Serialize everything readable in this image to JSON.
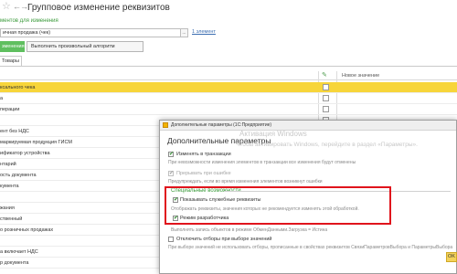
{
  "window": {
    "title": "Групповое изменение реквизитов",
    "star_icon": "star-icon",
    "back_icon": "←",
    "forward_icon": "→"
  },
  "form": {
    "section_label": "ментов для изменения",
    "combo_value": "ичная продажа (чек)",
    "combo_link": "1 элемент",
    "action_button": "зменения",
    "algorithm_button": "Выполнить произвольный алгоритм",
    "tab_label": "Товары"
  },
  "table": {
    "pencil_icon": "✎",
    "new_value_header": "Новое значение",
    "rows": [
      {
        "label": "ксального чека",
        "selected": true
      },
      {
        "label": "а",
        "selected": false
      },
      {
        "label": "перации",
        "selected": false
      },
      {
        "label": "",
        "selected": false
      },
      {
        "label": "ент без НДС",
        "selected": false
      },
      {
        "label": "маркируемая продукция ГИСМ",
        "selected": false
      },
      {
        "label": "ификатор устройства",
        "selected": false
      },
      {
        "label": "нтарий",
        "selected": false
      },
      {
        "label": "ость документа",
        "selected": false
      },
      {
        "label": "кумента",
        "selected": false
      },
      {
        "label": "",
        "selected": false
      },
      {
        "label": "жания",
        "selected": false
      },
      {
        "label": "ственный",
        "selected": false
      },
      {
        "label": "о розничных продажах",
        "selected": false
      },
      {
        "label": "",
        "selected": false
      },
      {
        "label": "а включает НДС",
        "selected": false
      },
      {
        "label": "р документа",
        "selected": false
      }
    ]
  },
  "dialog": {
    "titlebar": "Дополнительные параметры   (1С:Предприятие)",
    "heading": "Дополнительные параметры",
    "change_in_transaction": "Изменять в транзакции",
    "change_in_transaction_hint": "При невозможности изменения элементов в транзакции все изменения будут отменены",
    "interrupt_on_error": "Прерывать при ошибке",
    "interrupt_on_error_hint": "Предупреждать, если во время изменения элементов возникнут ошибки",
    "special_section": "Специальные возможности",
    "show_service_attrs": "Показывать служебные реквизиты",
    "show_service_attrs_hint": "Отображать реквизиты, значения которых не рекомендуется изменять этой обработкой.",
    "developer_mode": "Режим разработчика",
    "exchange_hint": "Выполнять запись объектов в режиме ОбменДанными.Загрузка = Истина",
    "disable_selection": "Отключить отборы при выборе значений",
    "disable_selection_hint": "При выборе значений не использовать отборы, прописанные в свойствах реквизитов СвязиПараметровВыбора и ПараметрыВыбора",
    "watermark_1": "Активация Windows",
    "watermark_2": "Чтобы активировать Windows, перейдите в раздел «Параметры».",
    "ok_button": "OK"
  },
  "colors": {
    "accent_green": "#5fbf5f",
    "selected_row": "#f7d53a",
    "highlight_box": "#e0141c"
  }
}
